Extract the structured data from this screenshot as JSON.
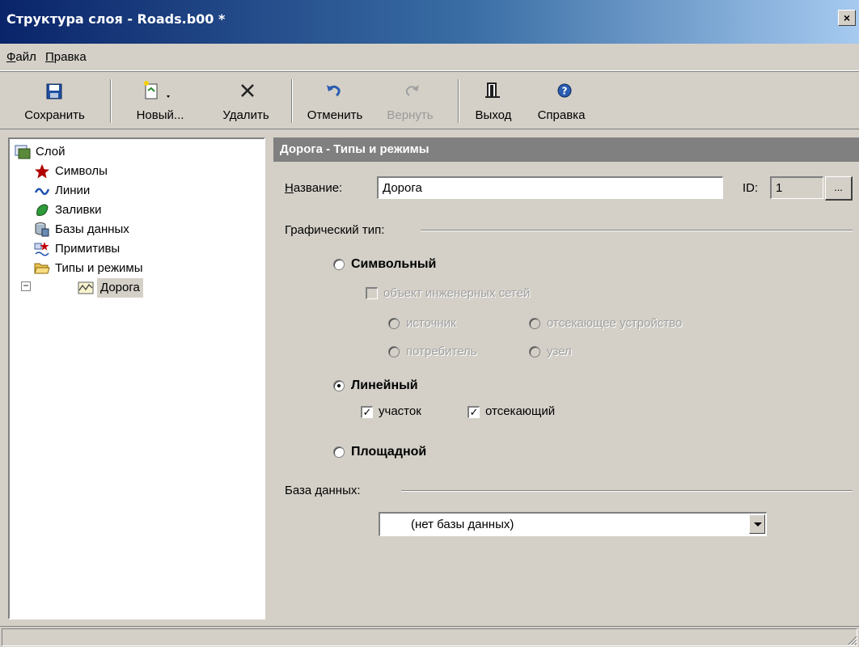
{
  "window": {
    "title": "Структура слоя - Roads.b00 *",
    "close": "×"
  },
  "menu": [
    {
      "label": "Файл",
      "accel": "Ф",
      "rest": "айл"
    },
    {
      "label": "Правка",
      "accel": "П",
      "rest": "равка"
    }
  ],
  "toolbar": {
    "save": "Сохранить",
    "new": "Новый...",
    "delete": "Удалить",
    "undo": "Отменить",
    "redo": "Вернуть",
    "exit": "Выход",
    "help": "Справка"
  },
  "tree": {
    "root": "Слой",
    "symbols": "Символы",
    "lines": "Линии",
    "fills": "Заливки",
    "databases": "Базы данных",
    "primitives": "Примитивы",
    "types": "Типы и режимы",
    "road": "Дорога",
    "expander": "−"
  },
  "panel": {
    "header": "Дорога - Типы и режимы",
    "name_label_accel": "Н",
    "name_label_rest": "азвание:",
    "name_value": "Дорога",
    "id_label": "ID:",
    "id_value": "1",
    "id_button": "...",
    "graphic_type_label": "Графический тип:",
    "symbolic": "Символьный",
    "engineering": "объект инженерных сетей",
    "source": "источник",
    "cutoff_device": "отсекающее устройство",
    "consumer": "потребитель",
    "node": "узел",
    "linear": "Линейный",
    "segment": "участок",
    "cutting": "отсекающий",
    "areal": "Площадной",
    "database_label": "База данных:",
    "database_value": "(нет базы данных)"
  },
  "colors": {
    "face": "#d4d0c8",
    "title_start": "#0a246a",
    "title_end": "#a6caf0",
    "header": "#808080"
  }
}
